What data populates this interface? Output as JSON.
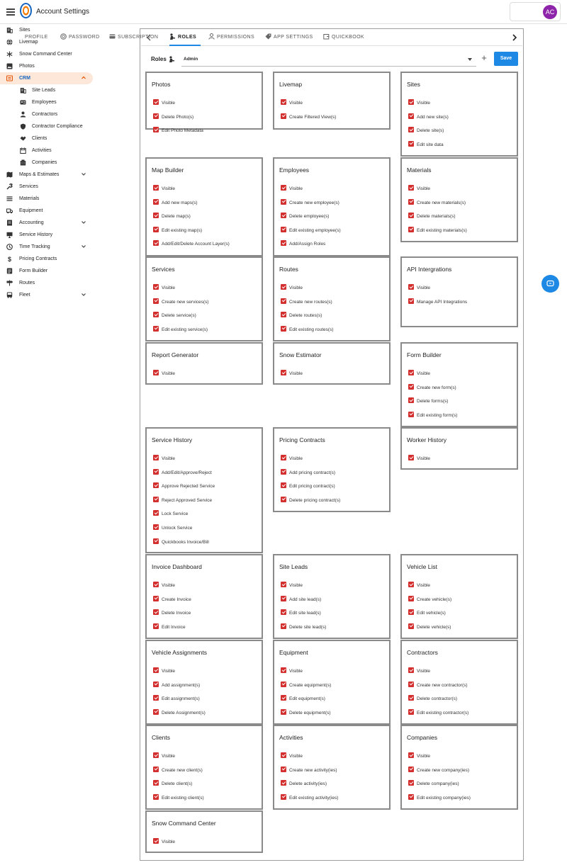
{
  "header": {
    "title": "Account Settings",
    "user_initials": "AC"
  },
  "colors": {
    "accent": "#1e88e5",
    "checkbox": "#d32f2f",
    "active_nav_bg": "#fde7d9",
    "avatar": "#8e24aa"
  },
  "sidebar": {
    "items": [
      {
        "label": "Sites",
        "icon": "building-icon"
      },
      {
        "label": "Livemap",
        "icon": "globe-icon"
      },
      {
        "label": "Snow Command Center",
        "icon": "snowflake-icon"
      },
      {
        "label": "Photos",
        "icon": "image-icon"
      },
      {
        "label": "CRM",
        "icon": "contacts-icon",
        "expanded": true,
        "active": true
      },
      {
        "label": "Site Leads",
        "icon": "building-icon",
        "sub": true
      },
      {
        "label": "Employees",
        "icon": "id-card-icon",
        "sub": true
      },
      {
        "label": "Contractors",
        "icon": "person-icon",
        "sub": true
      },
      {
        "label": "Contractor Compliance",
        "icon": "shield-icon",
        "sub": true
      },
      {
        "label": "Clients",
        "icon": "handshake-icon",
        "sub": true
      },
      {
        "label": "Activities",
        "icon": "calendar-icon",
        "sub": true
      },
      {
        "label": "Companies",
        "icon": "office-icon",
        "sub": true
      },
      {
        "label": "Maps & Estimates",
        "icon": "map-icon",
        "chevron": true
      },
      {
        "label": "Services",
        "icon": "wrench-icon"
      },
      {
        "label": "Materials",
        "icon": "layers-icon"
      },
      {
        "label": "Equipment",
        "icon": "truck-icon"
      },
      {
        "label": "Accounting",
        "icon": "ledger-icon",
        "chevron": true
      },
      {
        "label": "Service History",
        "icon": "history-icon"
      },
      {
        "label": "Time Tracking",
        "icon": "clock-icon",
        "chevron": true
      },
      {
        "label": "Pricing Contracts",
        "icon": "dollar-icon"
      },
      {
        "label": "Form Builder",
        "icon": "form-icon"
      },
      {
        "label": "Routes",
        "icon": "signpost-icon"
      },
      {
        "label": "Fleet",
        "icon": "bus-icon",
        "chevron": true
      }
    ]
  },
  "tabs": [
    {
      "label": "PROFILE",
      "icon": ""
    },
    {
      "label": "PASSWORD",
      "icon": "fingerprint-icon"
    },
    {
      "label": "SUBSCRIPTION",
      "icon": "card-icon"
    },
    {
      "label": "ROLES",
      "icon": "roles-icon",
      "active": true
    },
    {
      "label": "PERMISSIONS",
      "icon": "person-icon"
    },
    {
      "label": "APP SETTINGS",
      "icon": "tag-icon"
    },
    {
      "label": "QUICKBOOK",
      "icon": "sync-icon"
    }
  ],
  "roles": {
    "label": "Roles",
    "selected": "Admin",
    "save_label": "Save",
    "add_label": "+"
  },
  "cards": [
    {
      "title": "Photos",
      "perms": [
        "Visible",
        "Delete Photo(s)",
        "Edit Photo Metadata"
      ]
    },
    {
      "title": "Livemap",
      "perms": [
        "Visible",
        "Create Filtered View(s)"
      ]
    },
    {
      "title": "Sites",
      "perms": [
        "Visible",
        "Add new site(s)",
        "Delete site(s)",
        "Edit site data"
      ]
    },
    {
      "title": "Map Builder",
      "perms": [
        "Visible",
        "Add new maps(s)",
        "Delete map(s)",
        "Edit existing map(s)",
        "Add/Edit/Delete Account Layer(s)"
      ]
    },
    {
      "title": "Employees",
      "perms": [
        "Visible",
        "Create new employee(s)",
        "Delete employee(s)",
        "Edit existing employee(s)",
        "Add/Assign Roles"
      ]
    },
    {
      "title": "Materials",
      "perms": [
        "Visible",
        "Create new materials(s)",
        "Delete materials(s)",
        "Edit existing materials(s)"
      ]
    },
    {
      "title": "Services",
      "perms": [
        "Visible",
        "Create new services(s)",
        "Delete service(s)",
        "Edit existing service(s)"
      ]
    },
    {
      "title": "Routes",
      "perms": [
        "Visible",
        "Create new routes(s)",
        "Delete routes(s)",
        "Edit existing routes(s)"
      ]
    },
    {
      "title": "API Intergrations",
      "perms": [
        "Visible",
        "Manage API Integrations"
      ]
    },
    {
      "title": "Report Generator",
      "perms": [
        "Visible"
      ]
    },
    {
      "title": "Snow Estimator",
      "perms": [
        "Visible"
      ]
    },
    {
      "title": "Form Builder",
      "perms": [
        "Visible",
        "Create new form(s)",
        "Delete forms(s)",
        "Edit existing form(s)"
      ]
    },
    {
      "title": "Service History",
      "perms": [
        "Visible",
        "Add/Edit/Approve/Reject",
        "Approve Rejected Service",
        "Reject Approved Service",
        "Lock Service",
        "Unlock Service",
        "Quickbooks Invoice/Bill"
      ]
    },
    {
      "title": "Pricing Contracts",
      "perms": [
        "Visible",
        "Add pricing contract(s)",
        "Edit pricing contract(s)",
        "Delete pricing contract(s)"
      ]
    },
    {
      "title": "Worker History",
      "perms": [
        "Visible"
      ]
    },
    {
      "title": "Invoice Dashboard",
      "perms": [
        "Visible",
        "Create Invoice",
        "Delete Invoice",
        "Edit Invoice"
      ]
    },
    {
      "title": "Site Leads",
      "perms": [
        "Visible",
        "Add site lead(s)",
        "Edit site lead(s)",
        "Delete site lead(s)"
      ]
    },
    {
      "title": "Vehicle List",
      "perms": [
        "Visible",
        "Create vehicle(s)",
        "Edit vehicle(s)",
        "Delete vehicle(s)"
      ]
    },
    {
      "title": "Vehicle Assignments",
      "perms": [
        "Visible",
        "Add assignment(s)",
        "Edit assignment(s)",
        "Delete Assignment(s)"
      ]
    },
    {
      "title": "Equipment",
      "perms": [
        "Visible",
        "Create equipment(s)",
        "Edit equipment(s)",
        "Delete equipment(s)"
      ]
    },
    {
      "title": "Contractors",
      "perms": [
        "Visible",
        "Create new contractor(s)",
        "Delete contractor(s)",
        "Edit existing contractor(s)"
      ]
    },
    {
      "title": "Clients",
      "perms": [
        "Visible",
        "Create new client(s)",
        "Delete client(s)",
        "Edit existing client(s)"
      ]
    },
    {
      "title": "Activities",
      "perms": [
        "Visible",
        "Create new activity(ies)",
        "Delete activity(ies)",
        "Edit existing activity(ies)"
      ]
    },
    {
      "title": "Companies",
      "perms": [
        "Visible",
        "Create new company(ies)",
        "Delete company(ies)",
        "Edit existing company(ies)"
      ]
    },
    {
      "title": "Snow Command Center",
      "perms": [
        "Visible"
      ]
    }
  ]
}
